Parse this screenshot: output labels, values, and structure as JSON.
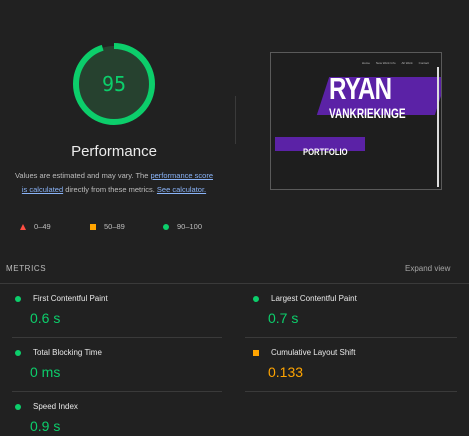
{
  "summary": {
    "score": "95",
    "score_fraction": 0.95,
    "score_color": "#0cce6b",
    "title": "Performance",
    "desc_part1": "Values are estimated and may vary. The ",
    "desc_link1": "performance score is calculated",
    "desc_part2": " directly from these metrics. ",
    "desc_link2": "See calculator."
  },
  "legend": [
    {
      "range": "0–49",
      "shape": "triangle",
      "color": "#ff4e42"
    },
    {
      "range": "50–89",
      "shape": "square",
      "color": "#ffa400"
    },
    {
      "range": "90–100",
      "shape": "circle",
      "color": "#0cce6b"
    }
  ],
  "screenshot": {
    "nav": [
      "Home",
      "New Work Info",
      "All Work",
      "Contact"
    ],
    "name_first": "RYAN",
    "name_last": "VANKRIEKINGE",
    "section": "PORTFOLIO"
  },
  "metrics": {
    "header": "METRICS",
    "expand": "Expand view",
    "items": [
      {
        "label": "First Contentful Paint",
        "value": "0.6 s",
        "status": "good"
      },
      {
        "label": "Largest Contentful Paint",
        "value": "0.7 s",
        "status": "good"
      },
      {
        "label": "Total Blocking Time",
        "value": "0 ms",
        "status": "good"
      },
      {
        "label": "Cumulative Layout Shift",
        "value": "0.133",
        "status": "average"
      },
      {
        "label": "Speed Index",
        "value": "0.9 s",
        "status": "good"
      }
    ]
  }
}
